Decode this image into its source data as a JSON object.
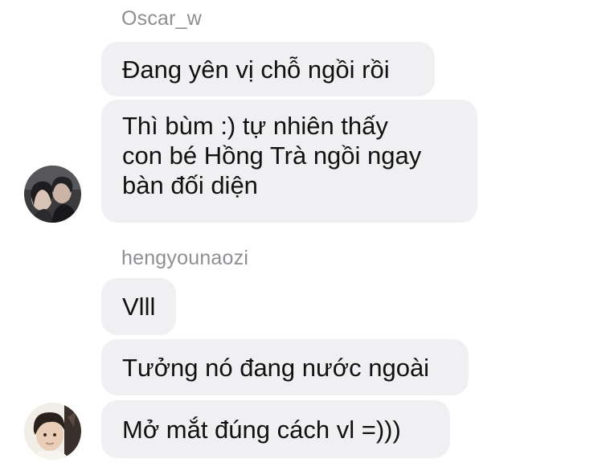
{
  "conversation": {
    "groups": [
      {
        "sender": "Oscar_w",
        "messages": [
          {
            "text": "Đang yên vị chỗ ngồi rồi"
          },
          {
            "lines": [
              "Thì bùm :) tự nhiên thấy",
              "con bé Hồng Trà ngồi ngay",
              "bàn đối diện"
            ]
          }
        ],
        "avatar_icon": "profile-photo-couple"
      },
      {
        "sender": "hengyounaozi",
        "messages": [
          {
            "text": "Vlll"
          },
          {
            "text": "Tưởng nó đang nước ngoài"
          },
          {
            "text": "Mở mắt đúng cách vl =)))"
          }
        ],
        "avatar_icon": "profile-photo-boy"
      }
    ]
  },
  "colors": {
    "bubble_background": "#f0f0f2",
    "sender_name": "#8e8e93",
    "message_text": "#111111",
    "page_background": "#ffffff"
  }
}
